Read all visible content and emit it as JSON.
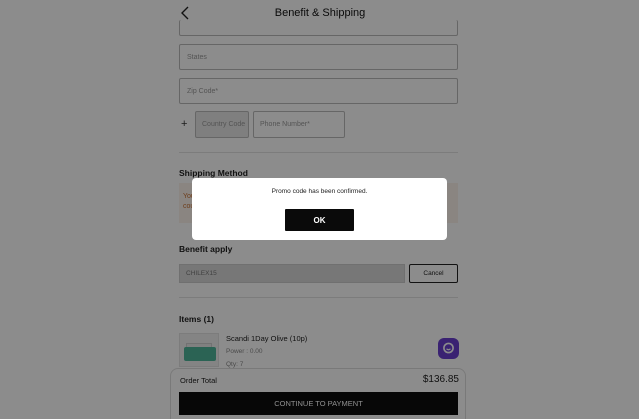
{
  "header": {
    "title": "Benefit & Shipping",
    "back_icon": "chevron-left-icon"
  },
  "address_form": {
    "states_placeholder": "States",
    "zip_placeholder": "Zip Code*",
    "phone_prefix": "+",
    "country_code_placeholder": "Country Code",
    "phone_placeholder": "Phone Number*"
  },
  "shipping": {
    "title": "Shipping Method",
    "notice_fragment_1": "You",
    "notice_fragment_2": "cou"
  },
  "benefit": {
    "title": "Benefit apply",
    "promo_value": "CHILEX15",
    "cancel_label": "Cancel"
  },
  "items": {
    "title": "Items (1)",
    "list": [
      {
        "name": "Scandi 1Day Olive (10p)",
        "power": "Power : 0.00",
        "qty": "Qty: 7"
      }
    ]
  },
  "chat": {
    "icon": "chat-bubble-icon",
    "color": "#6a3fd0"
  },
  "summary": {
    "order_total_label": "Order Total",
    "order_total_value": "$136.85",
    "continue_label": "CONTINUE TO PAYMENT"
  },
  "modal": {
    "message": "Promo code has been confirmed.",
    "ok_label": "OK"
  }
}
